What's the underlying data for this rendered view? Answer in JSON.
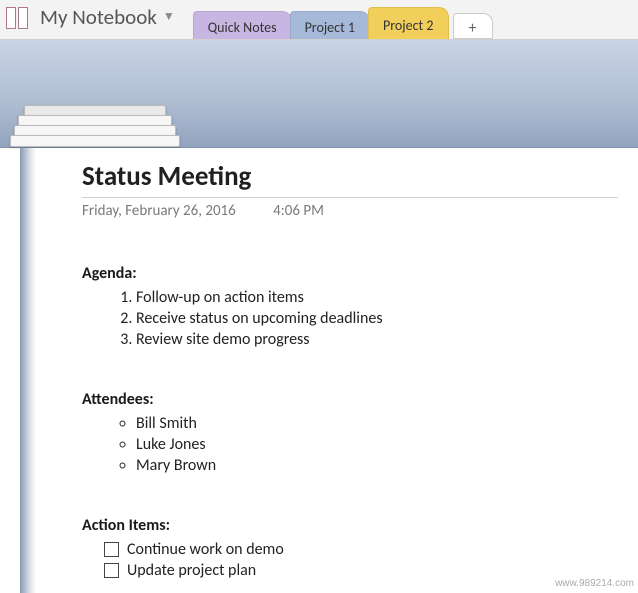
{
  "notebook": {
    "title": "My Notebook"
  },
  "tabs": [
    {
      "label": "Quick Notes",
      "color": "purple",
      "active": false
    },
    {
      "label": "Project 1",
      "color": "blue",
      "active": false
    },
    {
      "label": "Project 2",
      "color": "yellow",
      "active": true
    }
  ],
  "newTabGlyph": "+",
  "page": {
    "title": "Status Meeting",
    "date": "Friday, February 26, 2016",
    "time": "4:06 PM",
    "agenda": {
      "heading": "Agenda:",
      "items": [
        "Follow-up on action items",
        "Receive status on upcoming deadlines",
        "Review site demo progress"
      ]
    },
    "attendees": {
      "heading": "Attendees:",
      "items": [
        "Bill Smith",
        "Luke Jones",
        "Mary Brown"
      ]
    },
    "actionItems": {
      "heading": "Action Items:",
      "items": [
        {
          "label": "Continue work on demo",
          "checked": false
        },
        {
          "label": "Update project plan",
          "checked": false
        }
      ]
    }
  },
  "watermark": "www.989214.com"
}
